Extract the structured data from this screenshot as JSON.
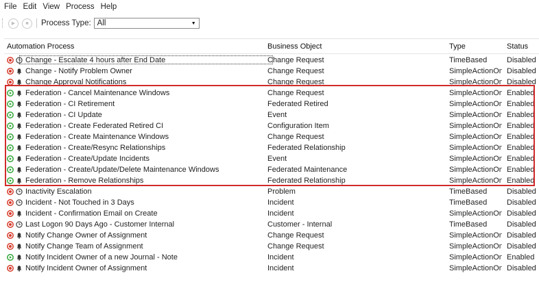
{
  "menubar": {
    "items": [
      "File",
      "Edit",
      "View",
      "Process",
      "Help"
    ]
  },
  "toolbar": {
    "process_type_label": "Process Type:",
    "process_type_value": "All"
  },
  "columns": {
    "name": "Automation Process",
    "object": "Business Object",
    "type": "Type",
    "status": "Status"
  },
  "colors": {
    "enabled": "#2fa535",
    "disabled": "#d63a2a",
    "highlight": "#d12a2a"
  },
  "rows": [
    {
      "status_icon": "stop-icon",
      "kind_icon": "clock-icon",
      "name": "Change - Escalate 4 hours after End Date",
      "object": "Change Request",
      "type": "TimeBased",
      "status": "Disabled"
    },
    {
      "status_icon": "stop-icon",
      "kind_icon": "bell-icon",
      "name": "Change - Notify Problem Owner",
      "object": "Change Request",
      "type": "SimpleActionOn...",
      "status": "Disabled"
    },
    {
      "status_icon": "stop-icon",
      "kind_icon": "bell-icon",
      "name": "Change Approval Notifications",
      "object": "Change Request",
      "type": "SimpleActionOn...",
      "status": "Disabled"
    },
    {
      "status_icon": "play-icon",
      "kind_icon": "bell-icon",
      "name": "Federation - Cancel Maintenance Windows",
      "object": "Change Request",
      "type": "SimpleActionOn...",
      "status": "Enabled"
    },
    {
      "status_icon": "play-icon",
      "kind_icon": "bell-icon",
      "name": "Federation - CI Retirement",
      "object": "Federated Retired",
      "type": "SimpleActionOn...",
      "status": "Enabled"
    },
    {
      "status_icon": "play-icon",
      "kind_icon": "bell-icon",
      "name": "Federation - CI Update",
      "object": "Event",
      "type": "SimpleActionOn...",
      "status": "Enabled"
    },
    {
      "status_icon": "play-icon",
      "kind_icon": "bell-icon",
      "name": "Federation - Create Federated Retired CI",
      "object": "Configuration Item",
      "type": "SimpleActionOn...",
      "status": "Enabled"
    },
    {
      "status_icon": "play-icon",
      "kind_icon": "bell-icon",
      "name": "Federation - Create Maintenance Windows",
      "object": "Change Request",
      "type": "SimpleActionOn...",
      "status": "Enabled"
    },
    {
      "status_icon": "play-icon",
      "kind_icon": "bell-icon",
      "name": "Federation - Create/Resync Relationships",
      "object": "Federated Relationship",
      "type": "SimpleActionOn...",
      "status": "Enabled"
    },
    {
      "status_icon": "play-icon",
      "kind_icon": "bell-icon",
      "name": "Federation - Create/Update Incidents",
      "object": "Event",
      "type": "SimpleActionOn...",
      "status": "Enabled"
    },
    {
      "status_icon": "play-icon",
      "kind_icon": "bell-icon",
      "name": "Federation - Create/Update/Delete Maintenance Windows",
      "object": "Federated Maintenance",
      "type": "SimpleActionOn...",
      "status": "Enabled"
    },
    {
      "status_icon": "play-icon",
      "kind_icon": "bell-icon",
      "name": "Federation - Remove Relationships",
      "object": "Federated Relationship",
      "type": "SimpleActionOn...",
      "status": "Enabled"
    },
    {
      "status_icon": "stop-icon",
      "kind_icon": "clock-icon",
      "name": "Inactivity Escalation",
      "object": "Problem",
      "type": "TimeBased",
      "status": "Disabled"
    },
    {
      "status_icon": "stop-icon",
      "kind_icon": "clock-icon",
      "name": "Incident -  Not Touched in 3 Days",
      "object": "Incident",
      "type": "TimeBased",
      "status": "Disabled"
    },
    {
      "status_icon": "stop-icon",
      "kind_icon": "bell-icon",
      "name": "Incident - Confirmation Email on Create",
      "object": "Incident",
      "type": "SimpleActionOn...",
      "status": "Disabled"
    },
    {
      "status_icon": "stop-icon",
      "kind_icon": "clock-icon",
      "name": "Last Logon 90 Days Ago - Customer Internal",
      "object": "Customer - Internal",
      "type": "TimeBased",
      "status": "Disabled"
    },
    {
      "status_icon": "stop-icon",
      "kind_icon": "bell-icon",
      "name": "Notify Change Owner of Assignment",
      "object": "Change Request",
      "type": "SimpleActionOn...",
      "status": "Disabled"
    },
    {
      "status_icon": "stop-icon",
      "kind_icon": "bell-icon",
      "name": "Notify Change Team of Assignment",
      "object": "Change Request",
      "type": "SimpleActionOn...",
      "status": "Disabled"
    },
    {
      "status_icon": "play-icon",
      "kind_icon": "bell-icon",
      "name": "Notify Incident Owner of a new Journal - Note",
      "object": "Incident",
      "type": "SimpleActionOn...",
      "status": "Enabled"
    },
    {
      "status_icon": "stop-icon",
      "kind_icon": "bell-icon",
      "name": "Notify Incident Owner of Assignment",
      "object": "Incident",
      "type": "SimpleActionOn...",
      "status": "Disabled"
    }
  ]
}
